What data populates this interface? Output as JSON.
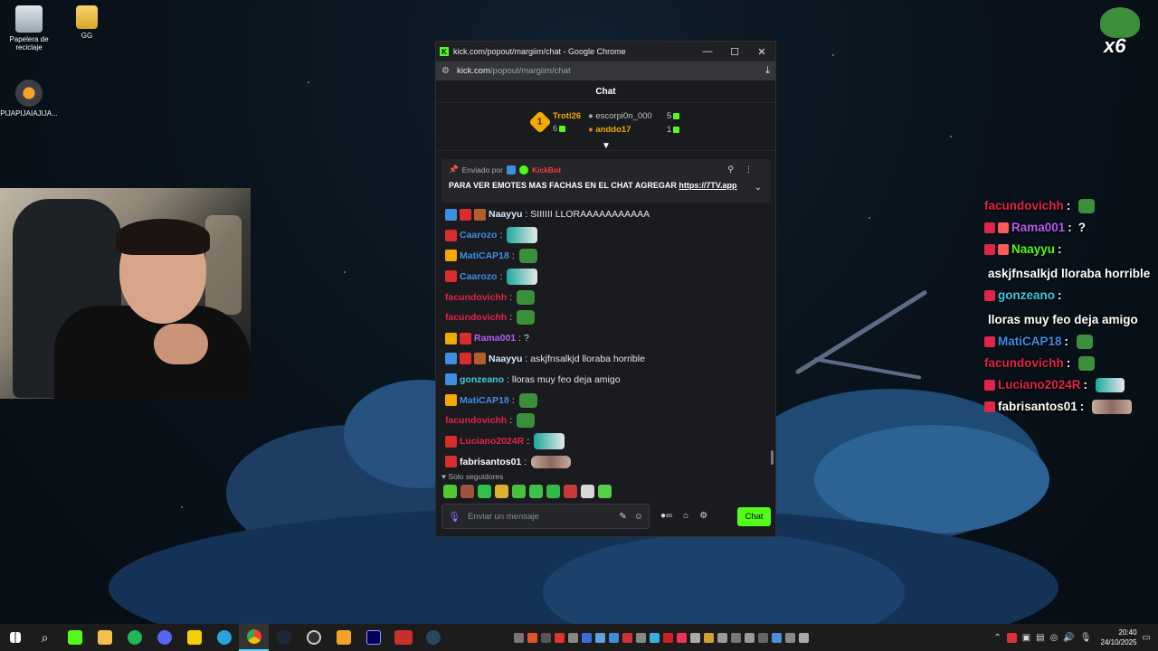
{
  "desktop": {
    "icons": [
      {
        "label": "Papelera de reciclaje"
      },
      {
        "label": "GG"
      },
      {
        "label": "PIJAPIJAIAJIJA..."
      }
    ]
  },
  "browser": {
    "title": "kick.com/popout/margiim/chat - Google Chrome",
    "url_host": "kick.com",
    "url_path": "/popout/margiim/chat",
    "window_controls": {
      "minimize": "—",
      "maximize": "☐",
      "close": "✕"
    }
  },
  "chat": {
    "header": "Chat",
    "leaderboard": {
      "rank_number": "1",
      "first": {
        "name": "Troti26",
        "count": "6"
      },
      "second": {
        "name": "escorpi0n_000",
        "count": "5"
      },
      "third": {
        "name": "anddo17",
        "count": "1"
      }
    },
    "pinned": {
      "sent_by_label": "Enviado por",
      "sender": "KickBot",
      "message": "PARA VER EMOTES MAS FACHAS EN EL CHAT AGREGAR",
      "link": "https://7TV.app"
    },
    "messages": [
      {
        "badges": [
          "blue",
          "red",
          "brown"
        ],
        "user": "Naayyu",
        "user_color": "#d8e9ff",
        "text": "SIIIIII LLORAAAAAAAAAAA",
        "emote": ""
      },
      {
        "badges": [
          "red"
        ],
        "user": "Caarozo",
        "user_color": "#3f8fe0",
        "text": "",
        "emote": "wide"
      },
      {
        "badges": [
          "gold"
        ],
        "user": "MatiCAP18",
        "user_color": "#3f8fe0",
        "text": "",
        "emote": "frog"
      },
      {
        "badges": [
          "red"
        ],
        "user": "Caarozo",
        "user_color": "#3f8fe0",
        "text": "",
        "emote": "wide"
      },
      {
        "badges": [],
        "user": "facundovichh",
        "user_color": "#e0244a",
        "text": "",
        "emote": "frog"
      },
      {
        "badges": [],
        "user": "facundovichh",
        "user_color": "#e0244a",
        "text": "",
        "emote": "frog"
      },
      {
        "badges": [
          "gold",
          "red"
        ],
        "user": "Rama001",
        "user_color": "#b45ff0",
        "text": "?",
        "emote": ""
      },
      {
        "badges": [
          "blue",
          "red",
          "brown"
        ],
        "user": "Naayyu",
        "user_color": "#d8e9ff",
        "text": "askjfnsalkjd lloraba horrible",
        "emote": ""
      },
      {
        "badges": [
          "blue"
        ],
        "user": "gonzeano",
        "user_color": "#3fc9e0",
        "text": "lloras muy feo deja amigo",
        "emote": ""
      },
      {
        "badges": [
          "gold"
        ],
        "user": "MatiCAP18",
        "user_color": "#3f8fe0",
        "text": "",
        "emote": "frog"
      },
      {
        "badges": [],
        "user": "facundovichh",
        "user_color": "#e0244a",
        "text": "",
        "emote": "frog"
      },
      {
        "badges": [
          "red"
        ],
        "user": "Luciano2024R",
        "user_color": "#e0244a",
        "text": "",
        "emote": "wide"
      },
      {
        "badges": [
          "red"
        ],
        "user": "fabrisantos01",
        "user_color": "#ffffff",
        "text": "",
        "emote": "img"
      }
    ],
    "followers_label": "Solo seguidores",
    "input_placeholder": "Enviar un mensaje",
    "send_label": "Chat"
  },
  "overlay": {
    "counter": "x6",
    "lines": [
      {
        "user": "facundovichh",
        "color": "#e0244a",
        "text": "",
        "emote": true,
        "badges": 0
      },
      {
        "user": "Rama001",
        "color": "#b45ff0",
        "text": "?",
        "emote": false,
        "badges": 2
      },
      {
        "user": "Naayyu",
        "color": "#53fc18",
        "text": "askjfnsalkjd lloraba horrible",
        "emote": false,
        "badges": 2
      },
      {
        "user": "gonzeano",
        "color": "#3fc9e0",
        "text": "lloras muy feo deja amigo",
        "emote": false,
        "badges": 1
      },
      {
        "user": "MatiCAP18",
        "color": "#3f8fe0",
        "text": "",
        "emote": true,
        "badges": 1
      },
      {
        "user": "facundovichh",
        "color": "#e0244a",
        "text": "",
        "emote": true,
        "badges": 0
      },
      {
        "user": "Luciano2024R",
        "color": "#e0244a",
        "text": "",
        "emote": true,
        "badges": 1
      },
      {
        "user": "fabrisantos01",
        "color": "#ffffff",
        "text": "",
        "emote": true,
        "badges": 1
      }
    ]
  },
  "taskbar": {
    "time": "20:40",
    "date": "24/10/2025"
  },
  "colors": {
    "kick_green": "#53fc18",
    "gold": "#f2a900"
  }
}
